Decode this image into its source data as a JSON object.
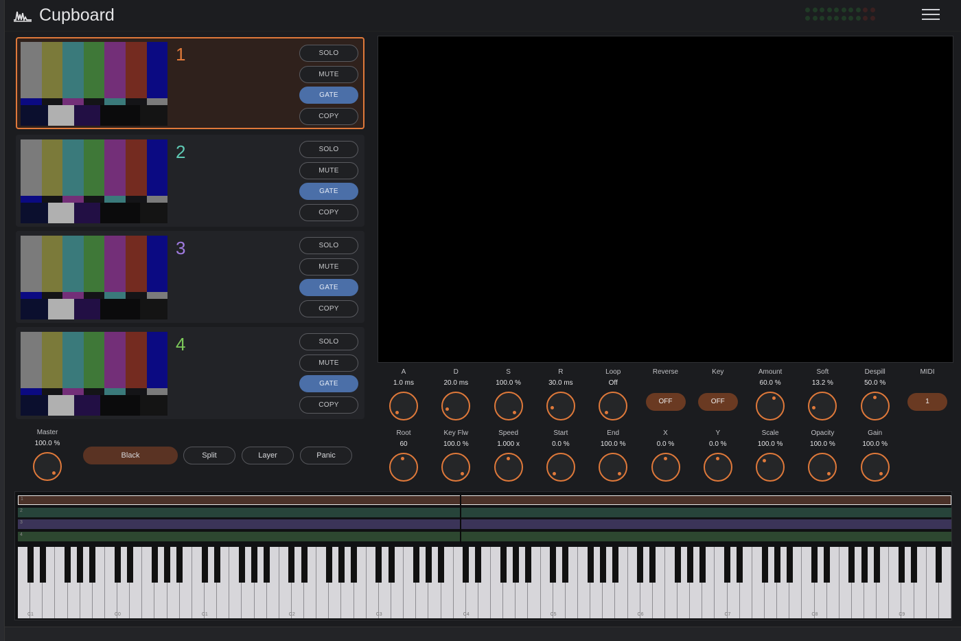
{
  "app": {
    "title": "Cupboard"
  },
  "colors": {
    "accent": "#e0793a",
    "active_button": "#4b6fa8",
    "pill": "#6a3a22"
  },
  "channels": [
    {
      "number": "1",
      "color": "#e0793a",
      "active": true,
      "buttons": [
        "SOLO",
        "MUTE",
        "GATE",
        "COPY"
      ],
      "gate_on": true
    },
    {
      "number": "2",
      "color": "#5fc9b4",
      "active": false,
      "buttons": [
        "SOLO",
        "MUTE",
        "GATE",
        "COPY"
      ],
      "gate_on": true
    },
    {
      "number": "3",
      "color": "#a07be0",
      "active": false,
      "buttons": [
        "SOLO",
        "MUTE",
        "GATE",
        "COPY"
      ],
      "gate_on": true
    },
    {
      "number": "4",
      "color": "#7cc85a",
      "active": false,
      "buttons": [
        "SOLO",
        "MUTE",
        "GATE",
        "COPY"
      ],
      "gate_on": true
    }
  ],
  "master": {
    "label": "Master",
    "value": "100.0 %",
    "level": 1.0
  },
  "modes": {
    "black": "Black",
    "split": "Split",
    "layer": "Layer",
    "panic": "Panic"
  },
  "controls_row1": [
    {
      "label": "A",
      "value": "1.0 ms",
      "type": "knob",
      "level": 0.0
    },
    {
      "label": "D",
      "value": "20.0 ms",
      "type": "knob",
      "level": 0.1
    },
    {
      "label": "S",
      "value": "100.0 %",
      "type": "knob",
      "level": 1.0
    },
    {
      "label": "R",
      "value": "30.0 ms",
      "type": "knob",
      "level": 0.12
    },
    {
      "label": "Loop",
      "value": "Off",
      "type": "knob",
      "level": 0.0
    },
    {
      "label": "Reverse",
      "value": "OFF",
      "type": "pill"
    },
    {
      "label": "Key",
      "value": "OFF",
      "type": "pill"
    },
    {
      "label": "Amount",
      "value": "60.0 %",
      "type": "knob",
      "level": 0.6
    },
    {
      "label": "Soft",
      "value": "13.2 %",
      "type": "knob",
      "level": 0.13
    },
    {
      "label": "Despill",
      "value": "50.0 %",
      "type": "knob",
      "level": 0.5
    },
    {
      "label": "MIDI",
      "value": "1",
      "type": "pill",
      "novalue": true
    }
  ],
  "controls_row2": [
    {
      "label": "Root",
      "value": "60",
      "level": 0.47
    },
    {
      "label": "Key Flw",
      "value": "100.0 %",
      "level": 1.0
    },
    {
      "label": "Speed",
      "value": "1.000 x",
      "level": 0.5
    },
    {
      "label": "Start",
      "value": "0.0 %",
      "level": 0.0
    },
    {
      "label": "End",
      "value": "100.0 %",
      "level": 1.0
    },
    {
      "label": "X",
      "value": "0.0 %",
      "level": 0.5
    },
    {
      "label": "Y",
      "value": "0.0 %",
      "level": 0.5
    },
    {
      "label": "Scale",
      "value": "100.0 %",
      "level": 0.35
    },
    {
      "label": "Opacity",
      "value": "100.0 %",
      "level": 1.0
    },
    {
      "label": "Gain",
      "value": "100.0 %",
      "level": 1.0
    }
  ],
  "lanes": [
    {
      "n": "1",
      "color": "#4a3128"
    },
    {
      "n": "2",
      "color": "#27443a"
    },
    {
      "n": "3",
      "color": "#3b3458"
    },
    {
      "n": "4",
      "color": "#2d4730"
    }
  ],
  "octaves": [
    "C1",
    "C0",
    "C1",
    "C2",
    "C3",
    "C4",
    "C5",
    "C6",
    "C7",
    "C8",
    "C9"
  ]
}
